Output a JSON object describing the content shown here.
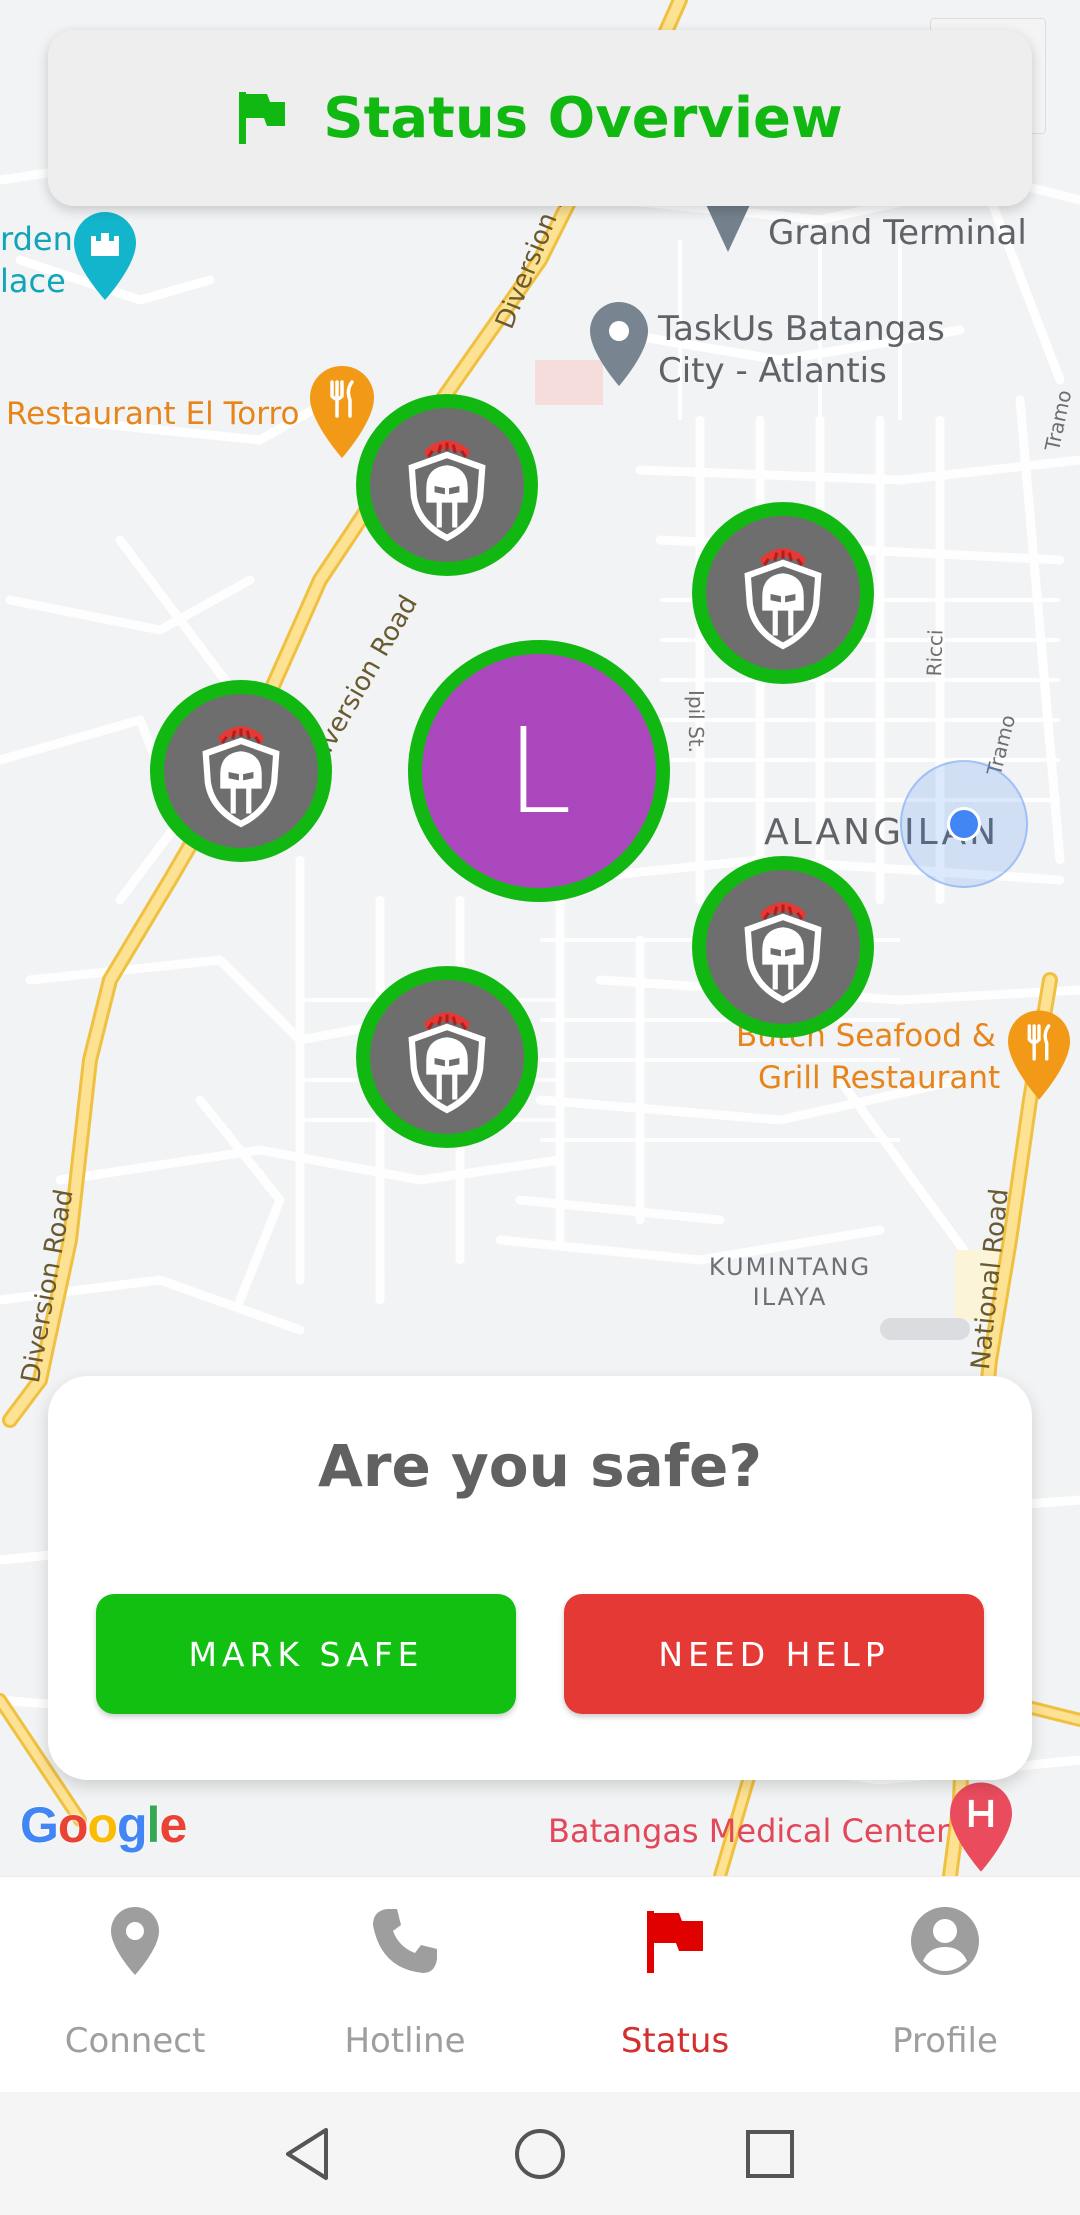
{
  "header": {
    "title": "Status Overview",
    "icon": "flag-icon",
    "accent": "#12b812"
  },
  "map": {
    "labels": {
      "garden_line1": "rden",
      "garden_line2": "lace",
      "grand_terminal": "Grand Terminal",
      "taskus_line1": "TaskUs Batangas",
      "taskus_line2": "City - Atlantis",
      "restaurant_el_torro": "Restaurant El Torro",
      "alangilan": "ALANGILAN",
      "butch_line1": "Butch Seafood &",
      "butch_line2": "Grill Restaurant",
      "kumintang_line1": "KUMINTANG",
      "kumintang_line2": "ILAYA",
      "diversion_road_top": "Diversion Road",
      "diversion_road_mid": "Diversion Road",
      "diversion_road_bottom": "Diversion Road",
      "national_road": "National Road",
      "ipil_st": "Ipil St.",
      "ricci": "Ricci",
      "tramo_1": "Tramo",
      "tramo_2": "Tramo",
      "batangas_medical": "Batangas Medical Center"
    },
    "center_marker_letter": "L",
    "center_marker_color": "#ab47bc",
    "google_logo": "Google"
  },
  "safety": {
    "question": "Are you safe?",
    "mark_safe_label": "MARK SAFE",
    "need_help_label": "NEED HELP",
    "safe_color": "#12c012",
    "help_color": "#e53935"
  },
  "nav": {
    "items": [
      {
        "label": "Connect",
        "icon": "location-pin-icon",
        "active": false
      },
      {
        "label": "Hotline",
        "icon": "phone-icon",
        "active": false
      },
      {
        "label": "Status",
        "icon": "flag-icon",
        "active": true
      },
      {
        "label": "Profile",
        "icon": "account-circle-icon",
        "active": false
      }
    ],
    "active_color": "#d32f2f",
    "inactive_color": "#9e9e9e"
  },
  "system_nav": {
    "back": "back-icon",
    "home": "home-icon",
    "recents": "recents-icon"
  }
}
